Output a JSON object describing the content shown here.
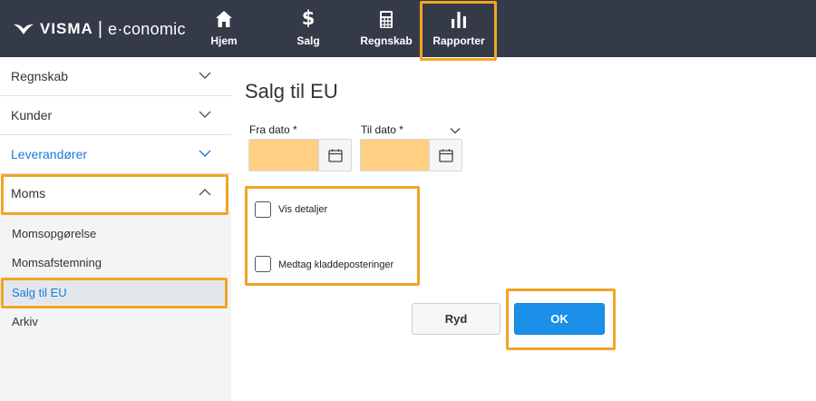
{
  "topbar": {
    "brand": "VISMA",
    "separator": "|",
    "product": "e·conomic",
    "nav": [
      {
        "label": "Hjem",
        "icon": "home-icon"
      },
      {
        "label": "Salg",
        "icon": "dollar-icon"
      },
      {
        "label": "Regnskab",
        "icon": "calculator-icon"
      },
      {
        "label": "Rapporter",
        "icon": "bar-chart-icon"
      }
    ]
  },
  "sidebar": {
    "sections": [
      {
        "label": "Regnskab",
        "state": "collapsed"
      },
      {
        "label": "Kunder",
        "state": "collapsed"
      },
      {
        "label": "Leverandører",
        "state": "collapsed"
      },
      {
        "label": "Moms",
        "state": "expanded"
      }
    ],
    "sub_items": [
      {
        "label": "Momsopgørelse"
      },
      {
        "label": "Momsafstemning"
      },
      {
        "label": "Salg til EU",
        "active": true
      },
      {
        "label": "Arkiv"
      }
    ]
  },
  "main": {
    "title": "Salg til EU",
    "from_date": {
      "label": "Fra dato *",
      "value": ""
    },
    "to_date": {
      "label": "Til dato *",
      "value": ""
    },
    "checkboxes": [
      {
        "label": "Vis detaljer",
        "checked": false
      },
      {
        "label": "Medtag kladdeposteringer",
        "checked": false
      }
    ],
    "buttons": {
      "clear": "Ryd",
      "ok": "OK"
    }
  },
  "colors": {
    "topbar": "#353a49",
    "highlight": "#f0a524",
    "accent_blue": "#1a7ad6",
    "ok_button": "#1a90e8",
    "date_field": "#ffd083"
  }
}
